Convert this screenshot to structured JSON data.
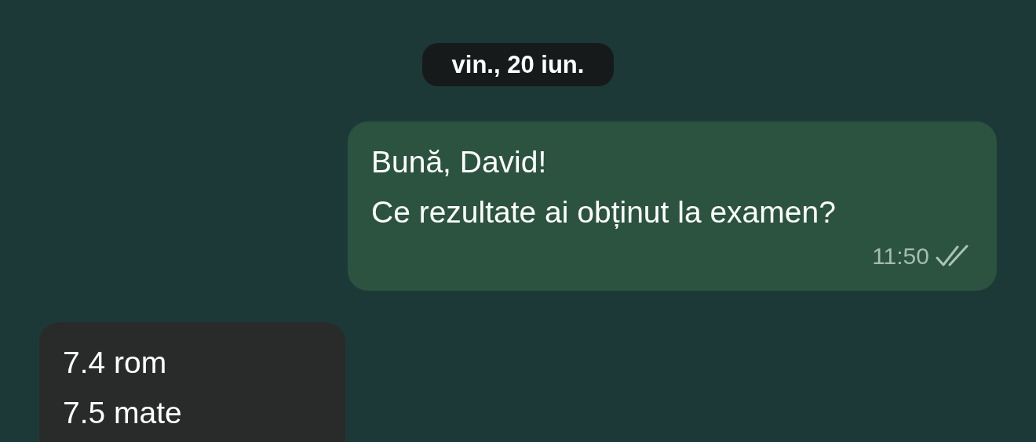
{
  "date_separator": "vin., 20 iun.",
  "messages": [
    {
      "kind": "outgoing",
      "lines": [
        "Bună, David!",
        "Ce rezultate ai obținut la examen?"
      ],
      "time": "11:50",
      "read": true
    },
    {
      "kind": "incoming",
      "lines": [
        "7.4 rom",
        "7.5 mate"
      ]
    }
  ]
}
